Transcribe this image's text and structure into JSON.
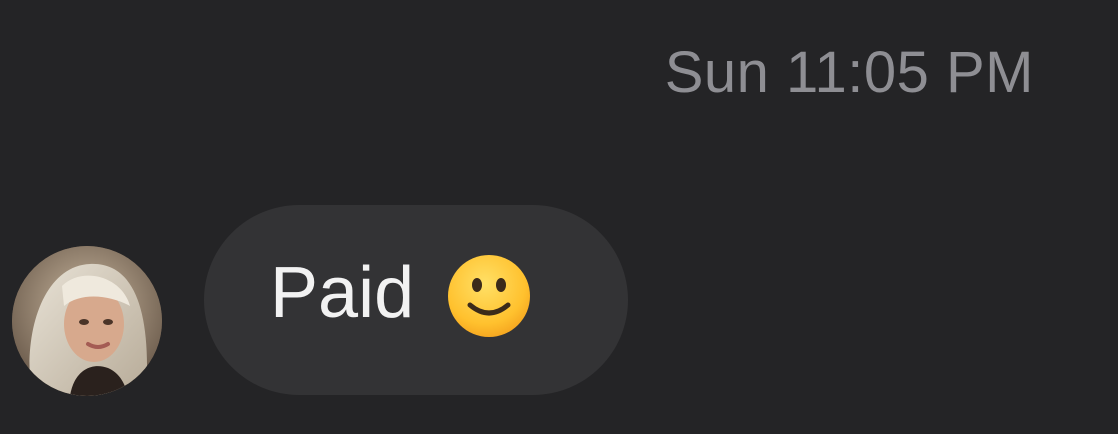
{
  "conversation": {
    "timestamp": "Sun 11:05 PM",
    "messages": [
      {
        "sender_avatar": "avatar-photo",
        "text": "Paid",
        "emoji": "slightly-smiling-face-icon"
      }
    ]
  },
  "colors": {
    "background": "#242426",
    "bubble": "#333335",
    "timestamp": "#8e8e93",
    "text": "#f2f2f2"
  }
}
